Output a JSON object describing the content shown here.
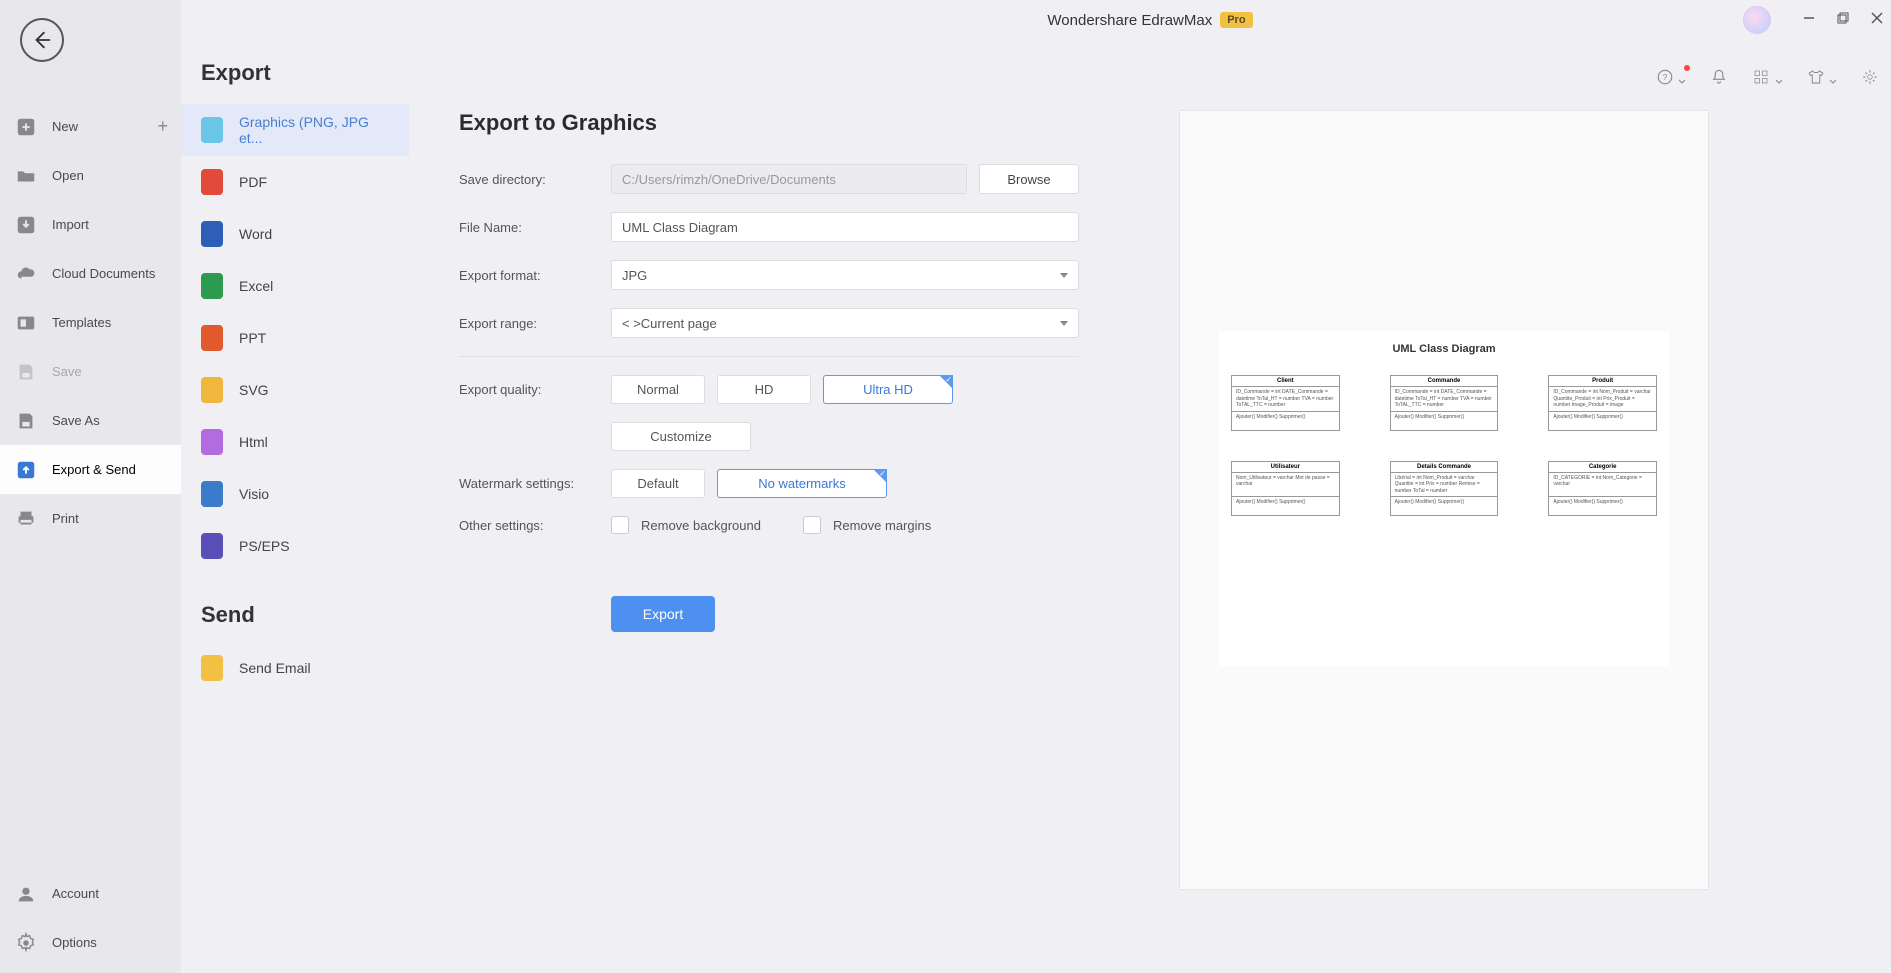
{
  "app": {
    "title": "Wondershare EdrawMax",
    "badge": "Pro"
  },
  "nav": {
    "items": [
      {
        "id": "new",
        "label": "New"
      },
      {
        "id": "open",
        "label": "Open"
      },
      {
        "id": "import",
        "label": "Import"
      },
      {
        "id": "cloud",
        "label": "Cloud Documents"
      },
      {
        "id": "templates",
        "label": "Templates"
      },
      {
        "id": "save",
        "label": "Save"
      },
      {
        "id": "saveas",
        "label": "Save As"
      },
      {
        "id": "exportsend",
        "label": "Export & Send"
      },
      {
        "id": "print",
        "label": "Print"
      }
    ],
    "bottom": [
      {
        "id": "account",
        "label": "Account"
      },
      {
        "id": "options",
        "label": "Options"
      }
    ]
  },
  "exportCol": {
    "title": "Export",
    "formats": [
      {
        "id": "graphics",
        "label": "Graphics (PNG, JPG et...",
        "color": "#6cc6e8"
      },
      {
        "id": "pdf",
        "label": "PDF",
        "color": "#e24a3a"
      },
      {
        "id": "word",
        "label": "Word",
        "color": "#2e5fb8"
      },
      {
        "id": "excel",
        "label": "Excel",
        "color": "#2d9b4f"
      },
      {
        "id": "ppt",
        "label": "PPT",
        "color": "#e05a2e"
      },
      {
        "id": "svg",
        "label": "SVG",
        "color": "#efb73e"
      },
      {
        "id": "html",
        "label": "Html",
        "color": "#b46be0"
      },
      {
        "id": "visio",
        "label": "Visio",
        "color": "#3a7cc9"
      },
      {
        "id": "pseps",
        "label": "PS/EPS",
        "color": "#5a4fb8"
      }
    ],
    "sendTitle": "Send",
    "sendItems": [
      {
        "id": "email",
        "label": "Send Email",
        "color": "#f2c143"
      }
    ]
  },
  "form": {
    "title": "Export to Graphics",
    "labels": {
      "saveDir": "Save directory:",
      "fileName": "File Name:",
      "exportFormat": "Export format:",
      "exportRange": "Export range:",
      "exportQuality": "Export quality:",
      "watermark": "Watermark settings:",
      "other": "Other settings:"
    },
    "saveDir": "C:/Users/rimzh/OneDrive/Documents",
    "browse": "Browse",
    "fileName": "UML Class Diagram",
    "exportFormat": "JPG",
    "exportRange": "Current page",
    "quality": {
      "normal": "Normal",
      "hd": "HD",
      "ultra": "Ultra HD",
      "custom": "Customize"
    },
    "watermark": {
      "default": "Default",
      "none": "No watermarks"
    },
    "other": {
      "removeBg": "Remove background",
      "removeMargins": "Remove margins"
    },
    "exportBtn": "Export"
  },
  "preview": {
    "title": "UML Class Diagram",
    "boxes": [
      {
        "name": "Client",
        "attrs": "ID_Commande = int\nDATE_Commande = datetime\nToTal_HT = number\nTVA = number\nToTAL_TTC = number",
        "ops": "Ajouter()\nModifier()\nSupprimer()"
      },
      {
        "name": "Commande",
        "attrs": "ID_Commande = int\nDATE_Commande = datetime\nToTal_HT = number\nTVA = number\nToTAL_TTC = number",
        "ops": "Ajouter()\nModifier()\nSupprimer()"
      },
      {
        "name": "Produit",
        "attrs": "ID_Commande = int\nNom_Produit = varchar\nQuantite_Produit = int\nPrix_Produit = number\nImage_Produit = image",
        "ops": "Ajouter()\nModifier()\nSupprimer()"
      },
      {
        "name": "Utilisateur",
        "attrs": "Nom_Utilisateur = varchar\nMot de passe = varchar",
        "ops": "Ajouter()\nModifier()\nSupprimer()"
      },
      {
        "name": "Details Commande",
        "attrs": "Libérial = int\nNom_Produit = varchar\nQuantite = int\nPrix = number\nRemise = number\nToTal = number",
        "ops": "Ajouter()\nModifier()\nSupprimer()"
      },
      {
        "name": "Categorie",
        "attrs": "ID_CATEGORIE = int\nNom_Categorie = varchar",
        "ops": "Ajouter()\nModifier()\nSupprimer()"
      }
    ]
  }
}
